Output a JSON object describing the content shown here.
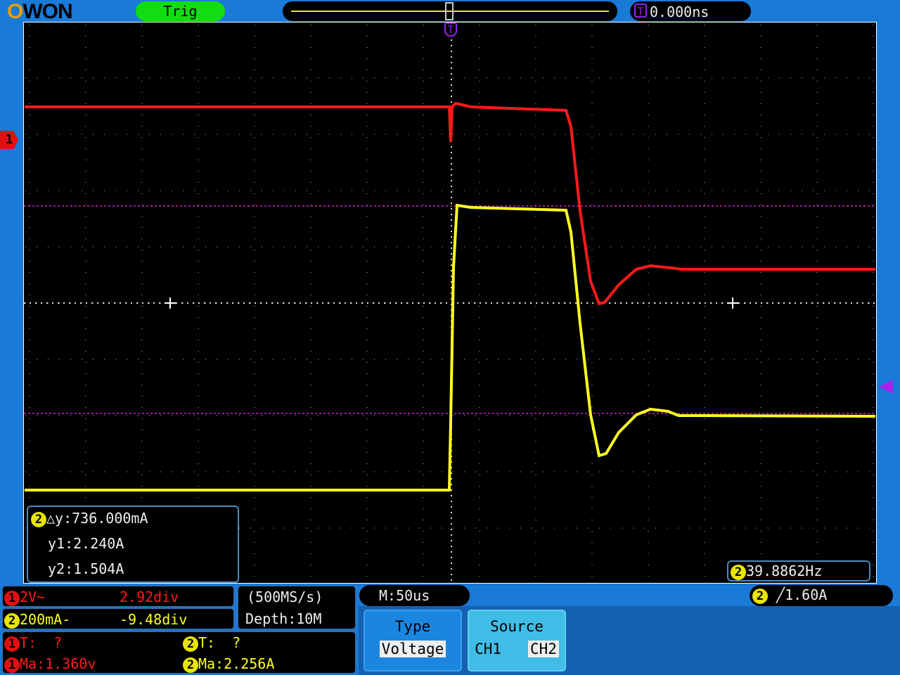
{
  "brand": {
    "logo_text": "OWON"
  },
  "top": {
    "trig_label": "Trig",
    "trigger_time": "0.000ns",
    "trigger_marker": "T"
  },
  "channel_markers": {
    "ch1": "1",
    "ch2": "2"
  },
  "cursor_readout": {
    "channel": "2",
    "delta": "△y:736.000mA",
    "y1": "y1:2.240A",
    "y2": "y2:1.504A"
  },
  "frequency": {
    "channel": "2",
    "value": "39.8862Hz"
  },
  "trigger_info": {
    "channel": "2",
    "edge_icon": "rising-edge-icon",
    "level": "1.60A"
  },
  "channels": [
    {
      "id": "1",
      "scale": "2V~",
      "offset": "2.92div",
      "color": "#ff1a1a"
    },
    {
      "id": "2",
      "scale": "200mA-",
      "offset": "-9.48div",
      "color": "#ffff22"
    }
  ],
  "acquisition": {
    "sample_rate": "(500MS/s)",
    "depth": "Depth:10M",
    "timebase": "M:50us"
  },
  "measurements": [
    {
      "channel": "1",
      "period": "T:  ?",
      "max": "Ma:1.360v"
    },
    {
      "channel": "2",
      "period": "T:  ?",
      "max": "Ma:2.256A"
    }
  ],
  "menu": {
    "type_label": "Type",
    "type_value": "Voltage",
    "source_label": "Source",
    "source_options": [
      "CH1",
      "CH2"
    ],
    "source_selected": "CH2"
  },
  "colors": {
    "ch1": "#ff1a1a",
    "ch2": "#ffff22",
    "cursor": "#cc22cc",
    "trigger": "#9922ee"
  }
}
